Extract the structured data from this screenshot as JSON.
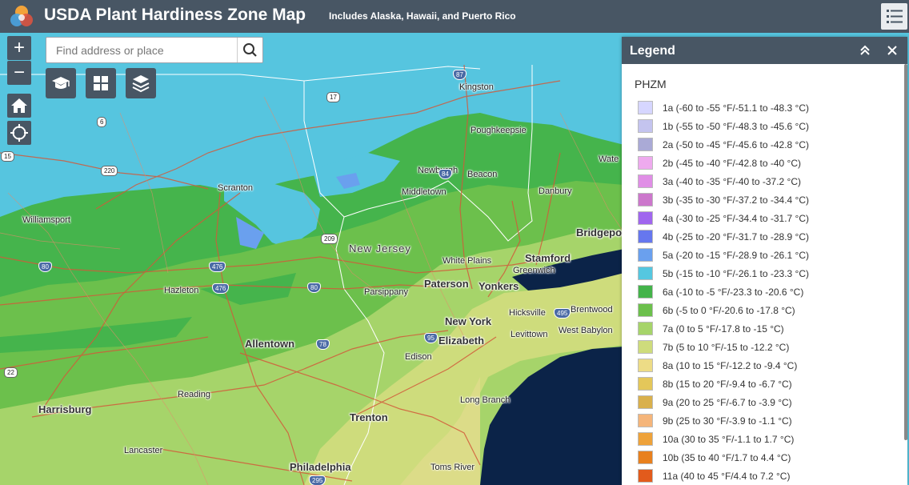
{
  "header": {
    "title": "USDA Plant Hardiness Zone Map",
    "subtitle": "Includes Alaska, Hawaii, and Puerto Rico"
  },
  "search": {
    "placeholder": "Find address or place"
  },
  "map_controls": {
    "zoom_in": "+",
    "zoom_out": "−"
  },
  "legend": {
    "title": "Legend",
    "layer": "PHZM",
    "items": [
      {
        "label": "1a (-60 to -55 °F/-51.1 to -48.3 °C)",
        "color": "#d6d6ff"
      },
      {
        "label": "1b (-55 to -50 °F/-48.3 to -45.6 °C)",
        "color": "#c4c4ef"
      },
      {
        "label": "2a (-50 to -45 °F/-45.6 to -42.8 °C)",
        "color": "#aaaad6"
      },
      {
        "label": "2b (-45 to -40 °F/-42.8 to -40 °C)",
        "color": "#eeaaee"
      },
      {
        "label": "3a (-40 to -35 °F/-40 to -37.2 °C)",
        "color": "#e08ee6"
      },
      {
        "label": "3b (-35 to -30 °F/-37.2 to -34.4 °C)",
        "color": "#cc77cc"
      },
      {
        "label": "4a (-30 to -25 °F/-34.4 to -31.7 °C)",
        "color": "#a066ee"
      },
      {
        "label": "4b (-25 to -20 °F/-31.7 to -28.9 °C)",
        "color": "#6677ee"
      },
      {
        "label": "5a (-20 to -15 °F/-28.9 to -26.1 °C)",
        "color": "#6aa0ee"
      },
      {
        "label": "5b (-15 to -10 °F/-26.1 to -23.3 °C)",
        "color": "#55c7e0"
      },
      {
        "label": "6a (-10 to -5 °F/-23.3 to -20.6 °C)",
        "color": "#44b34a"
      },
      {
        "label": "6b (-5 to 0 °F/-20.6 to -17.8 °C)",
        "color": "#6cc04c"
      },
      {
        "label": "7a (0 to 5 °F/-17.8 to -15 °C)",
        "color": "#a6d46a"
      },
      {
        "label": "7b (5 to 10 °F/-15 to -12.2 °C)",
        "color": "#cedc7c"
      },
      {
        "label": "8a (10 to 15 °F/-12.2 to -9.4 °C)",
        "color": "#eddc86"
      },
      {
        "label": "8b (15 to 20 °F/-9.4 to -6.7 °C)",
        "color": "#e4c75a"
      },
      {
        "label": "9a (20 to 25 °F/-6.7 to -3.9 °C)",
        "color": "#d9b04c"
      },
      {
        "label": "9b (25 to 30 °F/-3.9 to -1.1 °C)",
        "color": "#f5b57a"
      },
      {
        "label": "10a (30 to 35 °F/-1.1 to 1.7 °C)",
        "color": "#eea23a"
      },
      {
        "label": "10b (35 to 40 °F/1.7 to 4.4 °C)",
        "color": "#e8801e"
      },
      {
        "label": "11a (40 to 45 °F/4.4 to 7.2 °C)",
        "color": "#e25b1c"
      }
    ]
  },
  "map": {
    "places": [
      "Kingston",
      "Poughkeepsie",
      "Newburgh",
      "Beacon",
      "Middletown",
      "Danbury",
      "Wate",
      "Scranton",
      "Williamsport",
      "Hazleton",
      "New Jersey",
      "Bridgeport",
      "White Plains",
      "Stamford",
      "Greenwich",
      "Paterson",
      "Yonkers",
      "Parsippany",
      "Hicksville",
      "Brentwood",
      "Levittown",
      "West Babylon",
      "New York",
      "Elizabeth",
      "Allentown",
      "Edison",
      "Long Branch",
      "Harrisburg",
      "Reading",
      "Trenton",
      "Lancaster",
      "Philadelphia",
      "Toms River"
    ],
    "shields": [
      "87",
      "17",
      "6",
      "15",
      "220",
      "84",
      "209",
      "476",
      "80",
      "476",
      "80",
      "78",
      "95",
      "495",
      "22",
      "295"
    ]
  }
}
